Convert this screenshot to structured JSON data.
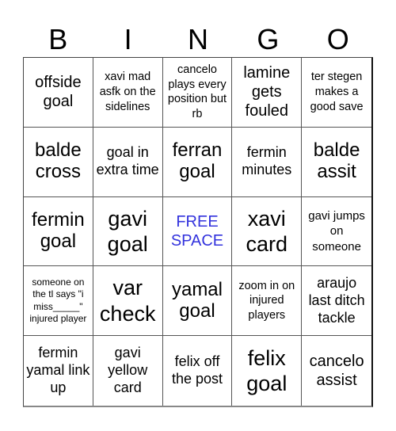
{
  "header": {
    "letters": [
      "B",
      "I",
      "N",
      "G",
      "O"
    ]
  },
  "colors": {
    "free_space": "#3333dd",
    "text": "#000000",
    "grid_line": "#555555"
  },
  "cells": [
    {
      "text": "offside goal"
    },
    {
      "text": "xavi mad asfk on the sidelines"
    },
    {
      "text": "cancelo plays every position but rb"
    },
    {
      "text": "lamine gets fouled"
    },
    {
      "text": "ter stegen makes a good save"
    },
    {
      "text": "balde cross"
    },
    {
      "text": "goal in extra time"
    },
    {
      "text": "ferran goal"
    },
    {
      "text": "fermin minutes"
    },
    {
      "text": "balde assit"
    },
    {
      "text": "fermin goal"
    },
    {
      "text": "gavi goal"
    },
    {
      "text": "FREE SPACE",
      "free": true
    },
    {
      "text": "xavi card"
    },
    {
      "text": "gavi jumps on someone"
    },
    {
      "text": "someone on the tl says \"i miss_____\" injured player"
    },
    {
      "text": "var check"
    },
    {
      "text": "yamal goal"
    },
    {
      "text": "zoom in on injured players"
    },
    {
      "text": "araujo last ditch tackle"
    },
    {
      "text": "fermin yamal link up"
    },
    {
      "text": "gavi yellow card"
    },
    {
      "text": "felix off the post"
    },
    {
      "text": "felix goal"
    },
    {
      "text": "cancelo assist"
    }
  ]
}
